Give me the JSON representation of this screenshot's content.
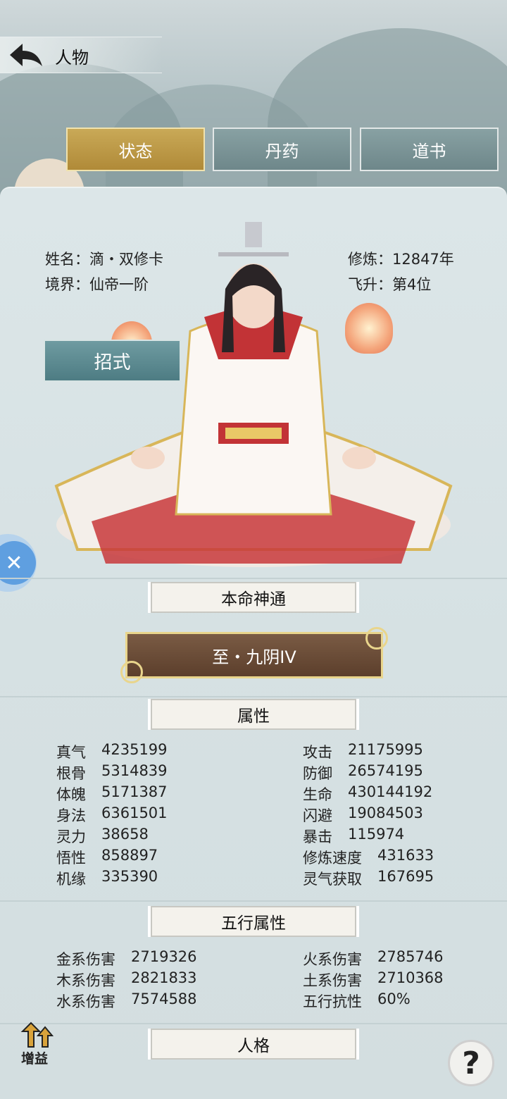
{
  "header": {
    "title": "人物"
  },
  "tabs": [
    {
      "label": "状态",
      "active": true
    },
    {
      "label": "丹药",
      "active": false
    },
    {
      "label": "道书",
      "active": false
    }
  ],
  "profile": {
    "name_label": "姓名：",
    "name": "滴・双修卡",
    "realm_label": "境界：",
    "realm": "仙帝一阶",
    "cultivation_label": "修炼：",
    "cultivation": "12847年",
    "ascend_label": "飞升：",
    "ascend": "第4位"
  },
  "skill_button": "招式",
  "sections": {
    "natal": "本命神通",
    "dao_name": "至・九阴IV",
    "attributes": "属性",
    "five_elements": "五行属性",
    "personality": "人格"
  },
  "attributes_left": [
    {
      "k": "真气",
      "v": "4235199"
    },
    {
      "k": "根骨",
      "v": "5314839"
    },
    {
      "k": "体魄",
      "v": "5171387"
    },
    {
      "k": "身法",
      "v": "6361501"
    },
    {
      "k": "灵力",
      "v": "38658"
    },
    {
      "k": "悟性",
      "v": "858897"
    },
    {
      "k": "机缘",
      "v": "335390"
    }
  ],
  "attributes_right": [
    {
      "k": "攻击",
      "v": "21175995"
    },
    {
      "k": "防御",
      "v": "26574195"
    },
    {
      "k": "生命",
      "v": "430144192"
    },
    {
      "k": "闪避",
      "v": "19084503"
    },
    {
      "k": "暴击",
      "v": "115974"
    },
    {
      "k": "修炼速度",
      "v": "431633"
    },
    {
      "k": "灵气获取",
      "v": "167695"
    }
  ],
  "elements_left": [
    {
      "k": "金系伤害",
      "v": "2719326"
    },
    {
      "k": "木系伤害",
      "v": "2821833"
    },
    {
      "k": "水系伤害",
      "v": "7574588"
    }
  ],
  "elements_right": [
    {
      "k": "火系伤害",
      "v": "2785746"
    },
    {
      "k": "土系伤害",
      "v": "2710368"
    },
    {
      "k": "五行抗性",
      "v": "60%"
    }
  ],
  "buff_label": "增益",
  "help_label": "?",
  "colors": {
    "active_tab": "#b8923f",
    "inactive_tab": "#7a9497",
    "skill_button": "#5b8b91",
    "dao_bg": "#6a4c37",
    "dao_border": "#e9d58c"
  }
}
